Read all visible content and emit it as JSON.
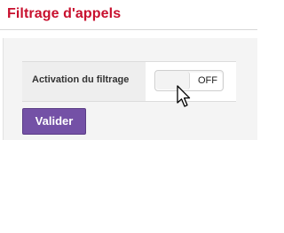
{
  "page": {
    "title": "Filtrage d'appels"
  },
  "form": {
    "rows": [
      {
        "label": "Activation du filtrage",
        "toggle": {
          "state_label": "OFF",
          "on": false
        }
      }
    ],
    "submit_label": "Valider"
  },
  "colors": {
    "title": "#c8102e",
    "submit_button": "#7451a6",
    "panel_background": "#f4f4f4"
  },
  "icons": {
    "cursor": "mouse-pointer-icon"
  }
}
